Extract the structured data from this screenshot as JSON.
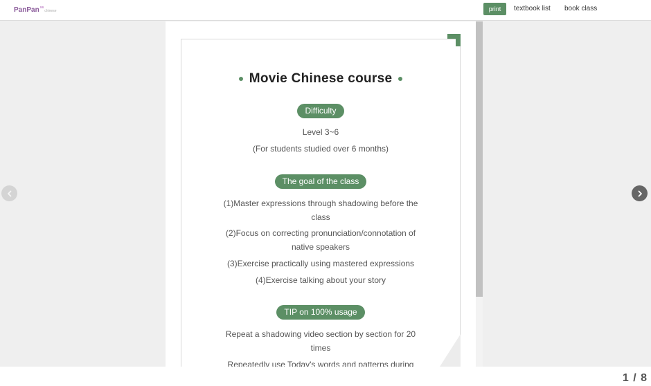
{
  "header": {
    "logo_main": "PanPan",
    "logo_sup": "ss",
    "logo_sub": "chinese",
    "print_label": "print",
    "textbook_list_label": "textbook list",
    "book_class_label": "book class"
  },
  "document": {
    "title": "Movie Chinese course",
    "difficulty": {
      "label": "Difficulty",
      "lines": [
        "Level 3~6",
        "(For students studied over 6 months)"
      ]
    },
    "goal": {
      "label": "The goal of the class",
      "lines": [
        "(1)Master expressions through shadowing before the",
        "class",
        "(2)Focus on correcting pronunciation/connotation of",
        "native speakers",
        "(3)Exercise practically using mastered expressions",
        "(4)Exercise talking about your story"
      ]
    },
    "tip": {
      "label": "TIP on 100% usage",
      "lines": [
        "Repeat a shadowing video section by section for 20",
        "times",
        "Repeatedly use Today's words and patterns during the"
      ]
    }
  },
  "pagination": {
    "indicator": "1 / 8"
  },
  "icons": {
    "prev": "chevron-left-icon",
    "next": "chevron-right-icon"
  },
  "colors": {
    "accent": "#5c8f65",
    "logo": "#8a5a9a"
  }
}
